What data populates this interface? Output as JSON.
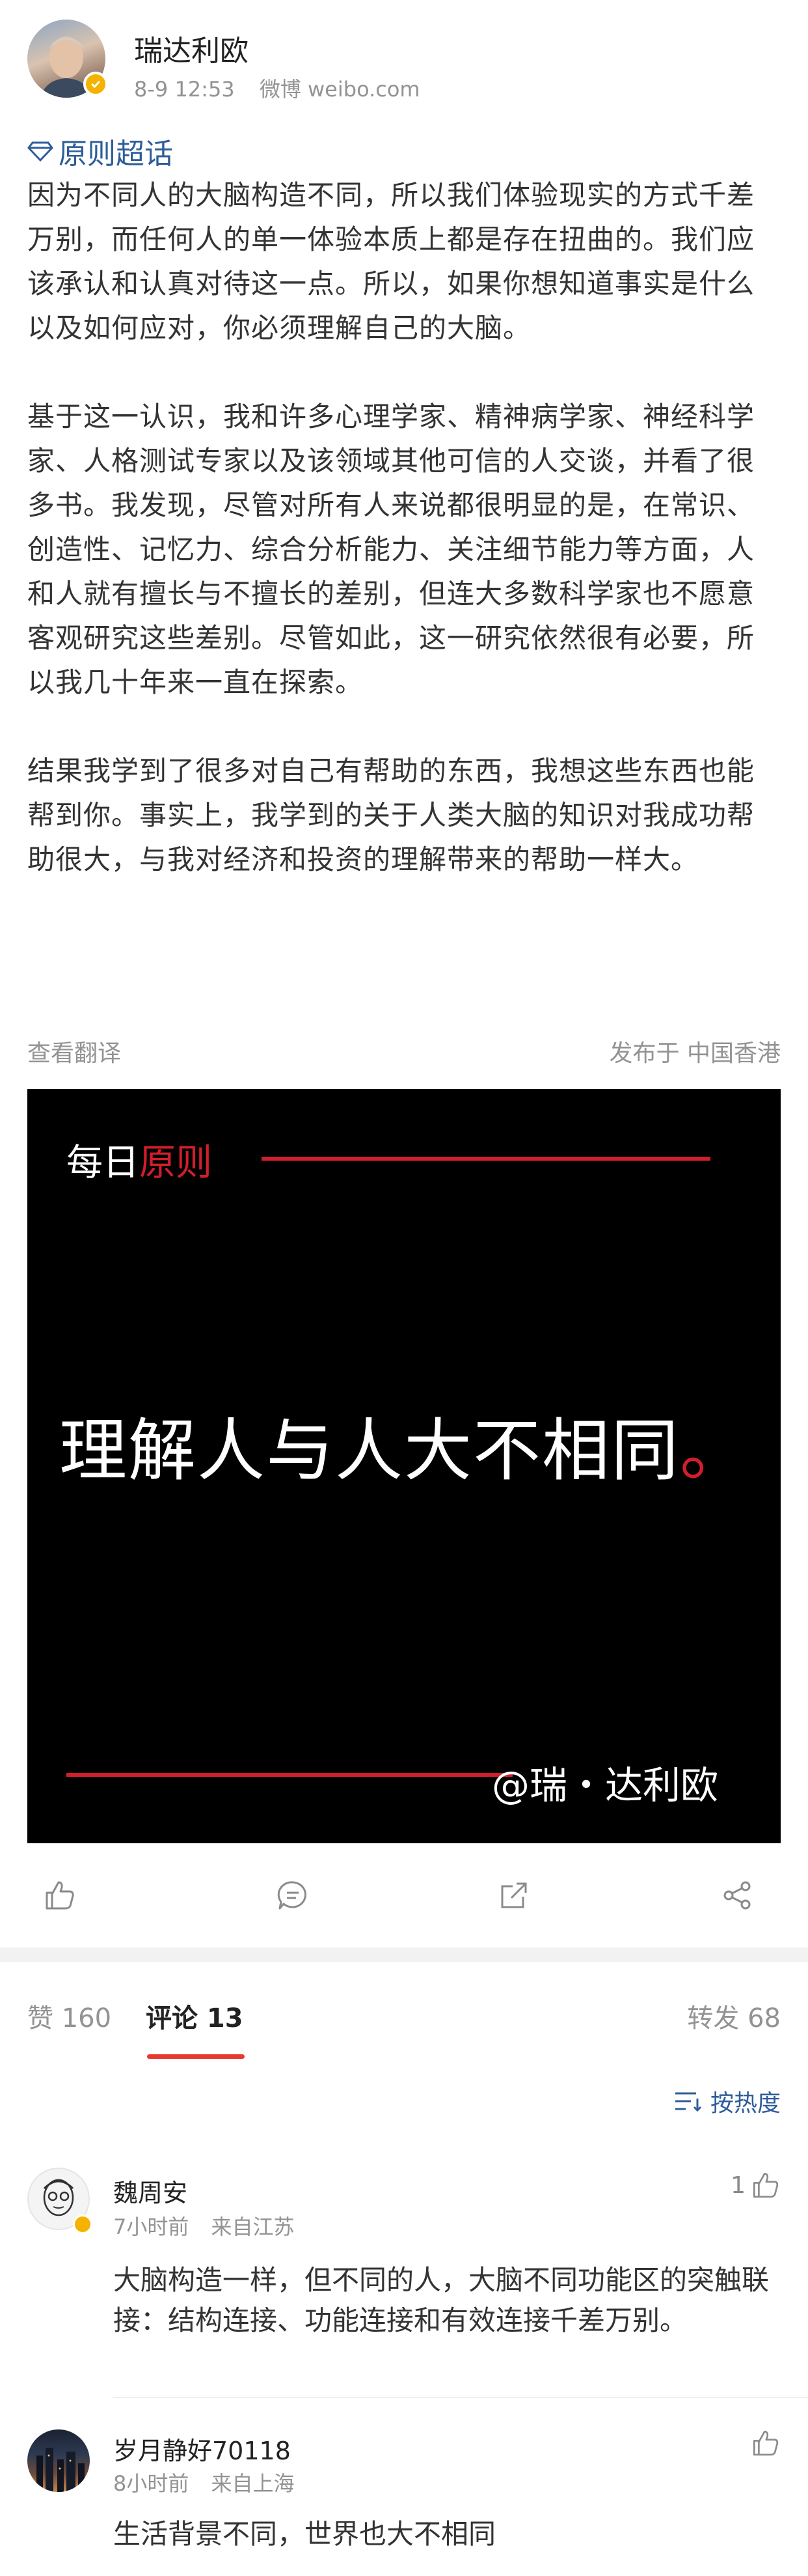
{
  "post": {
    "author": "瑞达利欧",
    "time": "8-9 12:53",
    "source": "微博 weibo.com",
    "topic": "原则超话",
    "paragraphs": [
      "因为不同人的大脑构造不同，所以我们体验现实的方式千差万别，而任何人的单一体验本质上都是存在扭曲的。我们应该承认和认真对待这一点。所以，如果你想知道事实是什么以及如何应对，你必须理解自己的大脑。",
      "基于这一认识，我和许多心理学家、精神病学家、神经科学家、人格测试专家以及该领域其他可信的人交谈，并看了很多书。我发现，尽管对所有人来说都很明显的是，在常识、创造性、记忆力、综合分析能力、关注细节能力等方面，人和人就有擅长与不擅长的差别，但连大多数科学家也不愿意客观研究这些差别。尽管如此，这一研究依然很有必要，所以我几十年来一直在探索。",
      "结果我学到了很多对自己有帮助的东西，我想这些东西也能帮到你。事实上，我学到的关于人类大脑的知识对我成功帮助很大，与我对经济和投资的理解带来的帮助一样大。"
    ],
    "translate": "查看翻译",
    "location": "发布于 中国香港"
  },
  "card": {
    "header_white": "每日",
    "header_red": "原则",
    "main_text": "理解人与人大不相同",
    "main_punct": "。",
    "signature": "@瑞・达利欧",
    "accent": "#d21e2b"
  },
  "tabs": {
    "likes": "赞 160",
    "comments": "评论 13",
    "reposts": "转发 68",
    "sort": "按热度"
  },
  "comments": [
    {
      "name": "魏周安",
      "time": "7小时前",
      "from": "来自江苏",
      "like_count": "1",
      "text": "大脑构造一样，但不同的人，大脑不同功能区的突触联接：结构连接、功能连接和有效连接千差万别。"
    },
    {
      "name": "岁月静好70118",
      "time": "8小时前",
      "from": "来自上海",
      "like_count": "",
      "text": "生活背景不同，世界也大不相同"
    }
  ],
  "colors": {
    "link": "#2e5d99",
    "verified": "#f5b300",
    "muted": "#939393",
    "divider": "#f2f2f2"
  }
}
